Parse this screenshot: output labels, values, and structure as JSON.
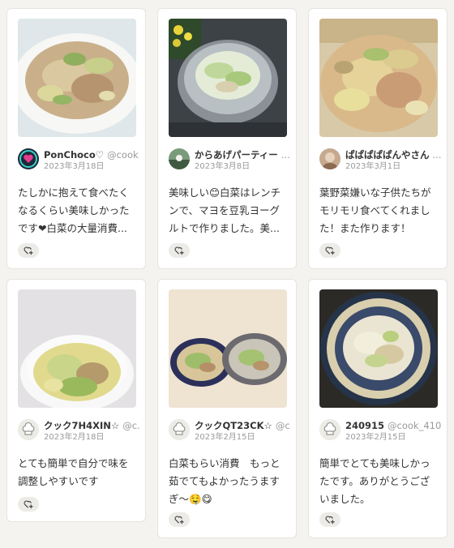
{
  "cards": [
    {
      "user_name": "PonChoco♡",
      "user_handle": "@cook...",
      "date": "2023年3月18日",
      "comment": "たしかに抱えて食べたくなるくらい美味しかったです❤白菜の大量消費...",
      "avatar_icon": "ghost-heart-avatar",
      "like_icon": "heart-plus-icon"
    },
    {
      "user_name": "からあげパーティー",
      "user_handle": "...",
      "date": "2023年3月8日",
      "comment": "美味しい😊白菜はレンチンで、マヨを豆乳ヨーグルトで作りました。美...",
      "avatar_icon": "photo-avatar",
      "like_icon": "heart-plus-icon"
    },
    {
      "user_name": "ぱぱぱぱぱんやさん",
      "user_handle": "...",
      "date": "2023年3月1日",
      "comment": "葉野菜嫌いな子供たちがモリモリ食べてくれました！また作ります！",
      "avatar_icon": "photo-avatar",
      "like_icon": "heart-plus-icon"
    },
    {
      "user_name": "クック7H4XIN☆",
      "user_handle": "@c...",
      "date": "2023年2月18日",
      "comment": "とても簡単で自分で味を調整しやすいです",
      "avatar_icon": "chef-hat-icon",
      "like_icon": "heart-plus-icon"
    },
    {
      "user_name": "クックQT23CK☆",
      "user_handle": "@c...",
      "date": "2023年2月15日",
      "comment": "白菜もらい消費　もっと茹でてもよかったうますぎ〜🤤😋",
      "avatar_icon": "chef-hat-icon",
      "like_icon": "heart-plus-icon"
    },
    {
      "user_name": "240915",
      "user_handle": "@cook_410...",
      "date": "2023年2月15日",
      "comment": "簡単でとても美味しかったです。ありがとうございました。",
      "avatar_icon": "chef-hat-icon",
      "like_icon": "heart-plus-icon"
    }
  ]
}
